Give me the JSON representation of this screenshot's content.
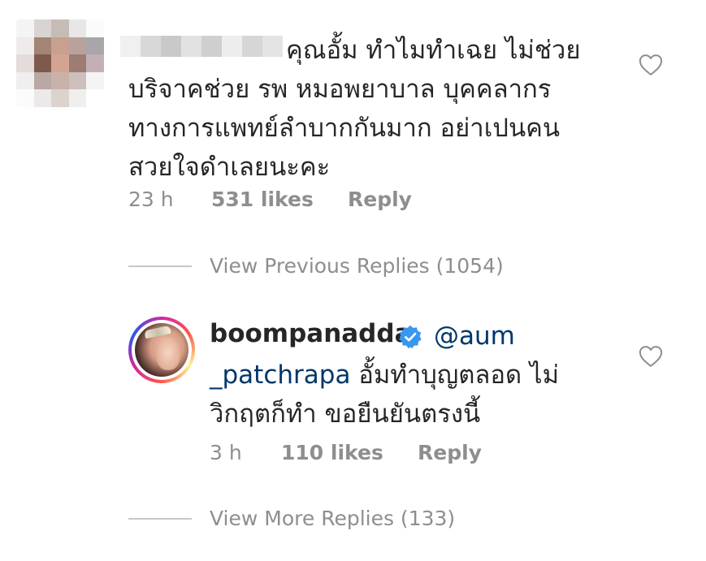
{
  "comment1": {
    "text_lines": [
      "คุณอั้ม ทำไมทำเฉย ไม่ช่วย",
      "บริจาคช่วย รพ หมอพยาบาล บุคคลากร",
      "ทางการแพทย์ลำบากกันมาก  อย่าเปนคน",
      "สวยใจดำเลยนะคะ"
    ],
    "time": "23 h",
    "likes": "531 likes",
    "reply_label": "Reply",
    "heart_icon": "heart-outline-icon"
  },
  "view_previous": "View Previous Replies (1054)",
  "comment2": {
    "username": "boompanadda",
    "verified_icon": "verified-badge-icon",
    "mention_part1": "@aum",
    "mention_part2": "_patchrapa",
    "line2_text": " อั้มทำบุญตลอด ไม่",
    "line3_text": "วิกฤตก็ทำ ขอยืนยันตรงนี้",
    "time": "3 h",
    "likes": "110 likes",
    "reply_label": "Reply",
    "heart_icon": "heart-outline-icon"
  },
  "view_more": "View More Replies (133)",
  "colors": {
    "text": "#262626",
    "meta": "#8e8e8e",
    "mention": "#00376b",
    "verified": "#3897f0",
    "divider": "#c7c7c7"
  }
}
